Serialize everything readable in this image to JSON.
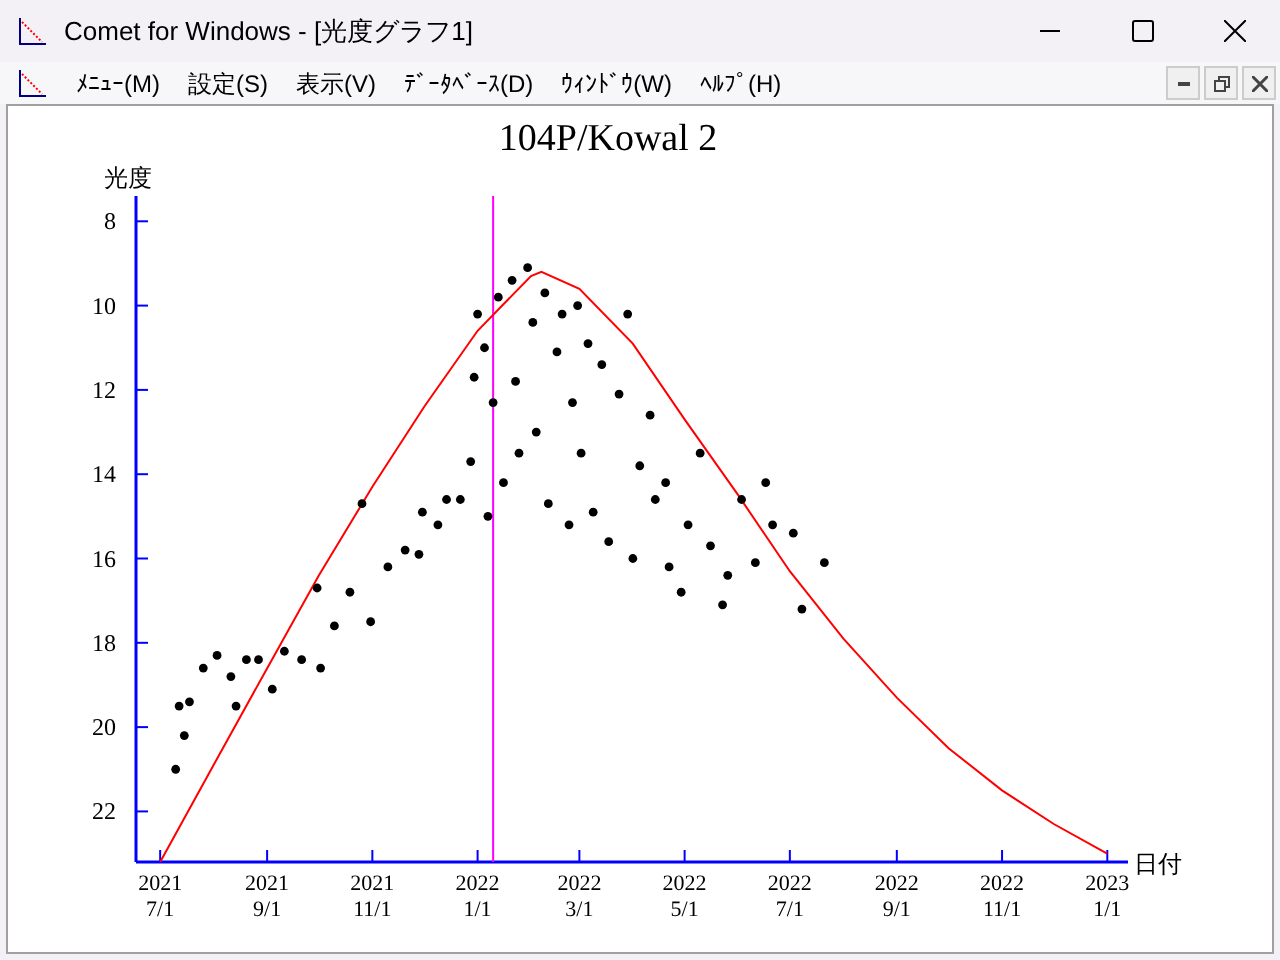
{
  "window": {
    "title": "Comet for Windows - [光度グラフ1]"
  },
  "menu": [
    "ﾒﾆｭｰ(M)",
    "設定(S)",
    "表示(V)",
    "ﾃﾞｰﾀﾍﾞｰｽ(D)",
    "ｳｨﾝﾄﾞｳ(W)",
    "ﾍﾙﾌﾟ(H)"
  ],
  "chart": {
    "chart_data": {
      "type": "scatter",
      "title": "104P/Kowal 2",
      "xlabel": "日付",
      "ylabel": "光度",
      "xlim": [
        "2021-06-17",
        "2023-01-13"
      ],
      "ylim": [
        23.2,
        7.4
      ],
      "xticks": [
        {
          "value": "2021-07-01",
          "label": "2021 7/1"
        },
        {
          "value": "2021-09-01",
          "label": "2021 9/1"
        },
        {
          "value": "2021-11-01",
          "label": "2021 11/1"
        },
        {
          "value": "2022-01-01",
          "label": "2022 1/1"
        },
        {
          "value": "2022-03-01",
          "label": "2022 3/1"
        },
        {
          "value": "2022-05-01",
          "label": "2022 5/1"
        },
        {
          "value": "2022-07-01",
          "label": "2022 7/1"
        },
        {
          "value": "2022-09-01",
          "label": "2022 9/1"
        },
        {
          "value": "2022-11-01",
          "label": "2022 11/1"
        },
        {
          "value": "2023-01-01",
          "label": "2023 1/1"
        }
      ],
      "yticks": [
        8,
        10,
        12,
        14,
        16,
        18,
        20,
        22
      ],
      "series": [
        {
          "type": "line",
          "color": "#ff0000",
          "x": [
            "2021-07-01",
            "2021-08-01",
            "2021-09-01",
            "2021-10-01",
            "2021-11-01",
            "2021-12-01",
            "2022-01-01",
            "2022-02-01",
            "2022-02-07",
            "2022-03-01",
            "2022-04-01",
            "2022-05-01",
            "2022-06-01",
            "2022-07-01",
            "2022-08-01",
            "2022-09-01",
            "2022-10-01",
            "2022-11-01",
            "2022-12-01",
            "2023-01-01"
          ],
          "values": [
            23.2,
            20.9,
            18.6,
            16.4,
            14.3,
            12.4,
            10.6,
            9.3,
            9.2,
            9.6,
            10.9,
            12.7,
            14.5,
            16.3,
            17.9,
            19.3,
            20.5,
            21.5,
            22.3,
            23.0
          ]
        },
        {
          "color": "#000000",
          "x": [
            "2021-07-10",
            "2021-07-12",
            "2021-07-15",
            "2021-07-18",
            "2021-07-26",
            "2021-08-03",
            "2021-08-11",
            "2021-08-14",
            "2021-08-20",
            "2021-08-27",
            "2021-09-04",
            "2021-09-11",
            "2021-09-21",
            "2021-09-30",
            "2021-10-02",
            "2021-10-10",
            "2021-10-19",
            "2021-10-26",
            "2021-10-31",
            "2021-11-10",
            "2021-11-20",
            "2021-11-28",
            "2021-11-30",
            "2021-12-09",
            "2021-12-14",
            "2021-12-22",
            "2021-12-28",
            "2021-12-30",
            "2022-01-01",
            "2022-01-05",
            "2022-01-07",
            "2022-01-10",
            "2022-01-13",
            "2022-01-16",
            "2022-01-21",
            "2022-01-23",
            "2022-01-25",
            "2022-01-30",
            "2022-02-02",
            "2022-02-04",
            "2022-02-09",
            "2022-02-11",
            "2022-02-16",
            "2022-02-19",
            "2022-02-23",
            "2022-02-25",
            "2022-02-28",
            "2022-03-02",
            "2022-03-06",
            "2022-03-09",
            "2022-03-14",
            "2022-03-18",
            "2022-03-24",
            "2022-03-29",
            "2022-04-01",
            "2022-04-05",
            "2022-04-11",
            "2022-04-14",
            "2022-04-20",
            "2022-04-22",
            "2022-04-29",
            "2022-05-03",
            "2022-05-10",
            "2022-05-16",
            "2022-05-23",
            "2022-05-26",
            "2022-06-03",
            "2022-06-11",
            "2022-06-17",
            "2022-06-21",
            "2022-07-03",
            "2022-07-08",
            "2022-07-21"
          ],
          "values": [
            21.0,
            19.5,
            20.2,
            19.4,
            18.6,
            18.3,
            18.8,
            19.5,
            18.4,
            18.4,
            19.1,
            18.2,
            18.4,
            16.7,
            18.6,
            17.6,
            16.8,
            14.7,
            17.5,
            16.2,
            15.8,
            15.9,
            14.9,
            15.2,
            14.6,
            14.6,
            13.7,
            11.7,
            10.2,
            11.0,
            15.0,
            12.3,
            9.8,
            14.2,
            9.4,
            11.8,
            13.5,
            9.1,
            10.4,
            13.0,
            9.7,
            14.7,
            11.1,
            10.2,
            15.2,
            12.3,
            10.0,
            13.5,
            10.9,
            14.9,
            11.4,
            15.6,
            12.1,
            10.2,
            16.0,
            13.8,
            12.6,
            14.6,
            14.2,
            16.2,
            16.8,
            15.2,
            13.5,
            15.7,
            17.1,
            16.4,
            14.6,
            16.1,
            14.2,
            15.2,
            15.4,
            17.2,
            16.1
          ]
        }
      ],
      "ref_lines": [
        {
          "axis": "x",
          "value": "2022-01-10"
        }
      ]
    }
  }
}
